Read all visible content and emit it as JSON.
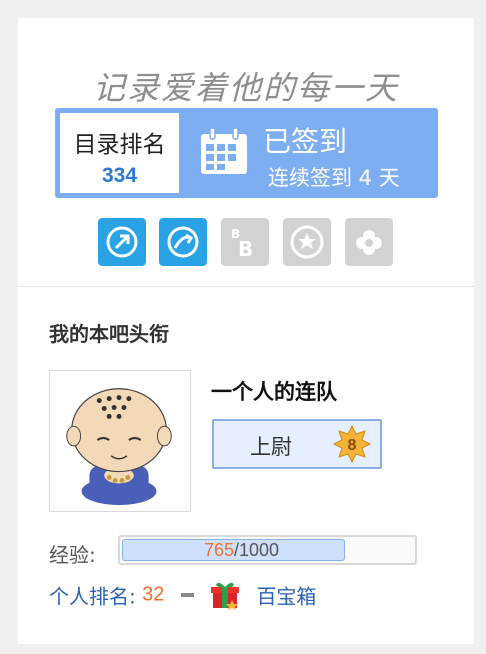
{
  "slogan": "记录爱着他的每一天",
  "sign": {
    "rank_label": "目录排名",
    "rank_value": "334",
    "status": "已签到",
    "streak": "连续签到 4 天"
  },
  "badges": [
    {
      "name": "badge-blue-arrow",
      "active": true
    },
    {
      "name": "badge-blue-swoosh",
      "active": true
    },
    {
      "name": "badge-b",
      "active": false
    },
    {
      "name": "badge-star",
      "active": false
    },
    {
      "name": "badge-flower",
      "active": false
    }
  ],
  "section": {
    "title": "我的本吧头衔",
    "group_name": "一个人的连队",
    "level_title": "上尉",
    "level_number": "8"
  },
  "exp": {
    "label": "经验:",
    "current": "765",
    "separator": "/",
    "max": "1000",
    "progress": 0.765
  },
  "ranking": {
    "label": "个人排名:",
    "value": "32",
    "treasure_label": "百宝箱"
  },
  "colors": {
    "accent_blue": "#7eaef2",
    "link_blue": "#2a62b8",
    "orange": "#f07030"
  }
}
